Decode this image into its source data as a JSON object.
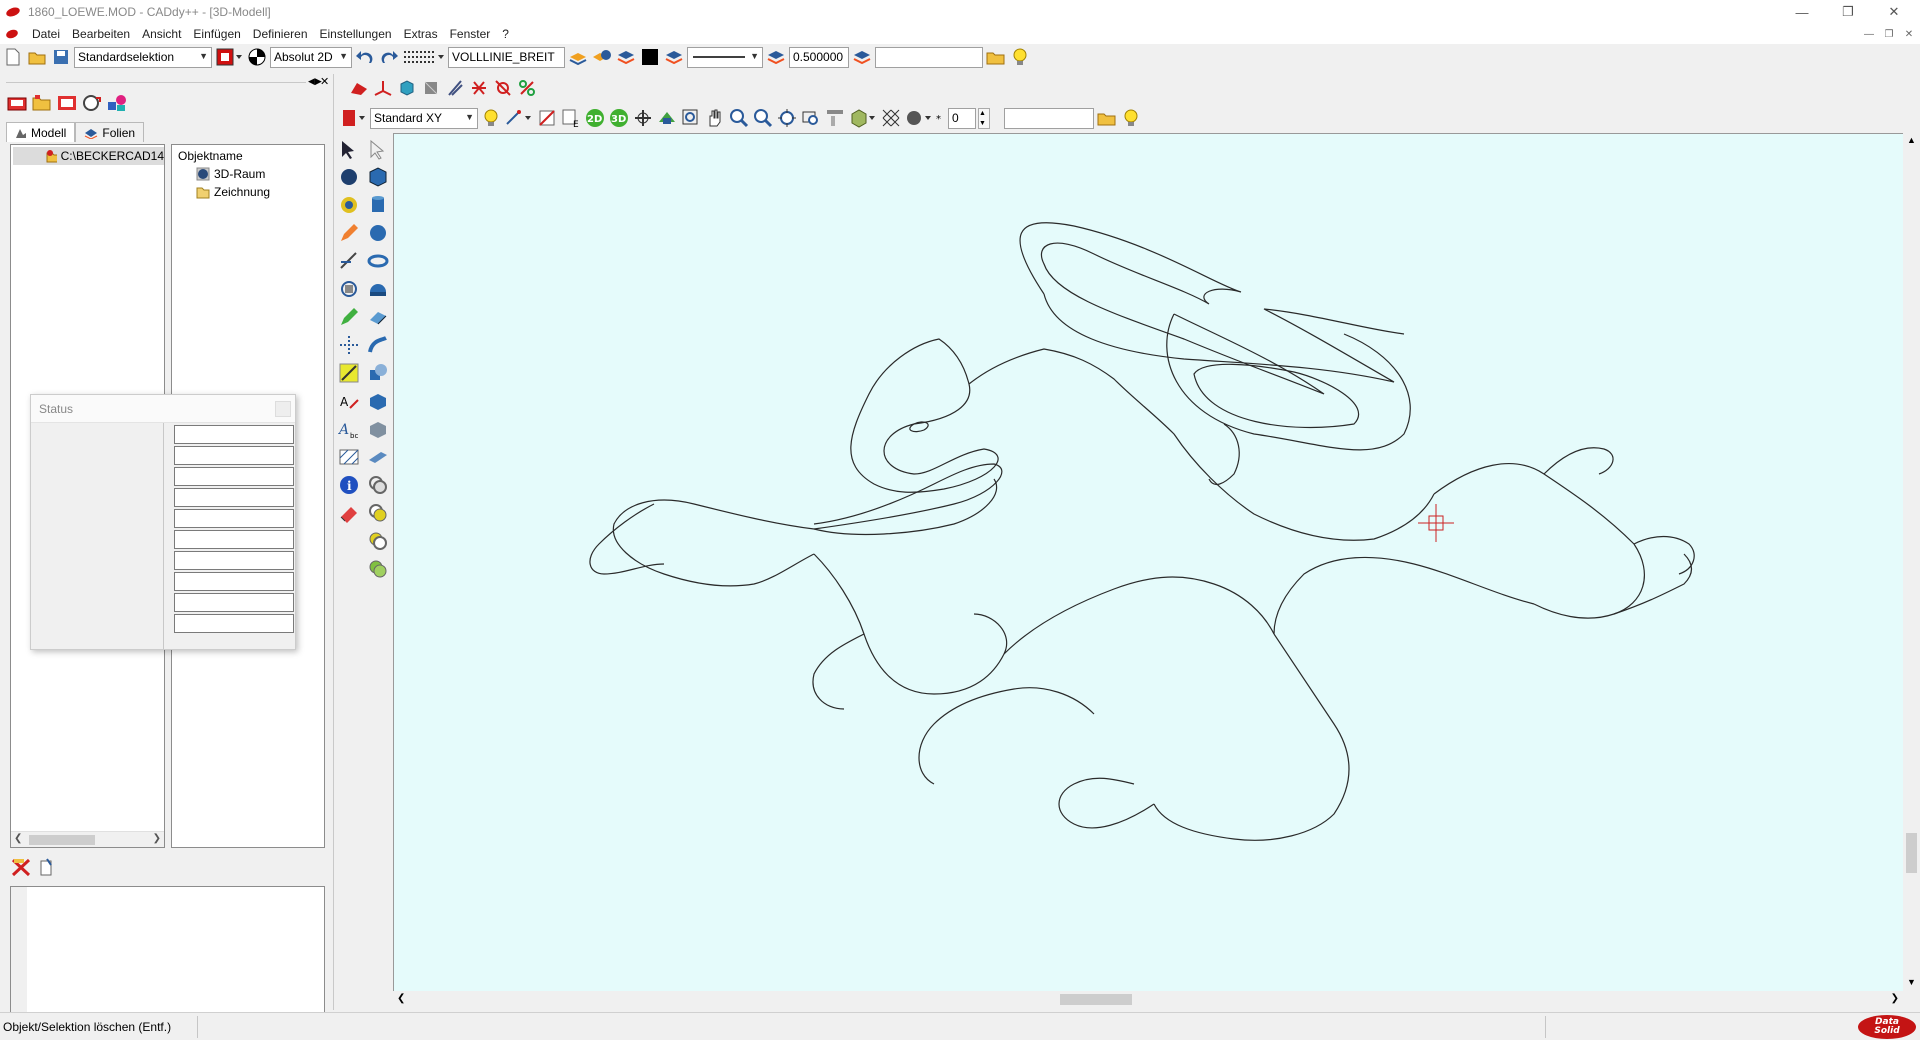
{
  "window": {
    "title": "1860_LOEWE.MOD  -  CADdy++ - [3D-Modell]",
    "controls": [
      "minimize",
      "restore",
      "close"
    ]
  },
  "menu": [
    "Datei",
    "Bearbeiten",
    "Ansicht",
    "Einfügen",
    "Definieren",
    "Einstellungen",
    "Extras",
    "Fenster",
    "?"
  ],
  "toolbar1": {
    "selection_mode": "Standardselektion",
    "coord_mode": "Absolut 2D",
    "line_type": "VOLLLINIE_BREIT",
    "line_width": "0.500000",
    "text_field": ""
  },
  "toolbar2": {
    "view": "Standard XY",
    "layer_value": "0",
    "text_field": ""
  },
  "left_panel": {
    "tabs": [
      "Modell",
      "Folien"
    ],
    "tree_root": "C:\\BECKERCAD14",
    "object_header": "Objektname",
    "objects": [
      "3D-Raum",
      "Zeichnung"
    ]
  },
  "status_dialog": {
    "title": "Status",
    "field_count": 10
  },
  "statusbar": {
    "message": "Objekt/Selektion löschen (Entf.)",
    "brand_line1": "Data",
    "brand_line2": "Solid"
  },
  "colors": {
    "viewport_background": "#e5fbfb",
    "drawing_line": "#2a2a2a",
    "cursor": "#cc2222",
    "brand": "#c41414"
  }
}
